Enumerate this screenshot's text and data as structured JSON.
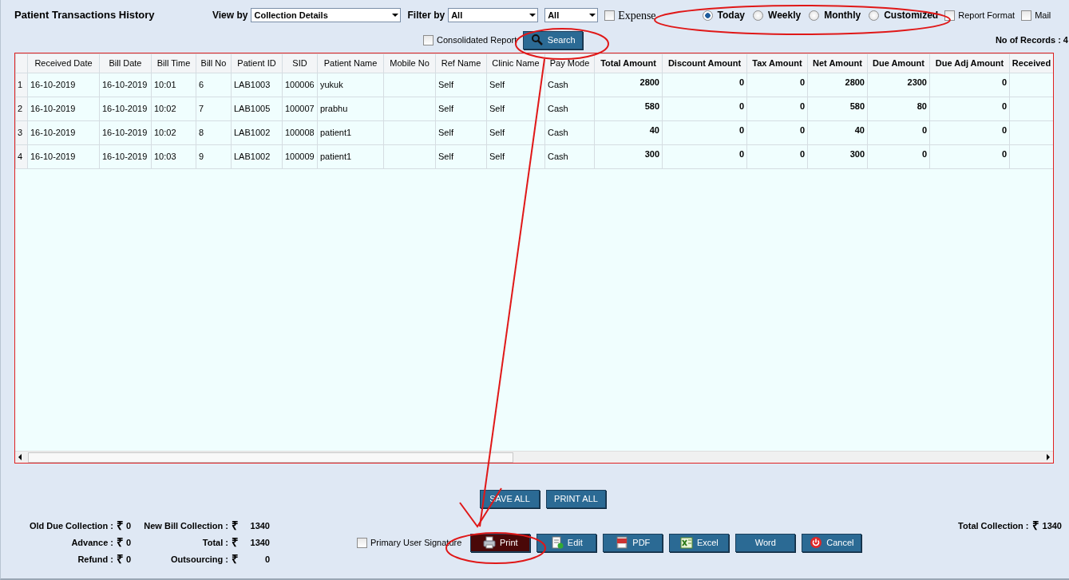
{
  "title": "Patient Transactions History",
  "toolbar": {
    "view_by_label": "View by",
    "view_by_value": "Collection Details",
    "filter_by_label": "Filter by",
    "filter_value": "All",
    "filter2_value": "All",
    "expense": {
      "label": "Expense",
      "checked": false
    },
    "periods": [
      {
        "label": "Today",
        "selected": true
      },
      {
        "label": "Weekly",
        "selected": false
      },
      {
        "label": "Monthly",
        "selected": false
      },
      {
        "label": "Customized",
        "selected": false
      }
    ],
    "report_format": {
      "label": "Report Format",
      "checked": false
    },
    "mail": {
      "label": "Mail",
      "checked": false
    },
    "consolidated": {
      "label": "Consolidated Report",
      "checked": false
    },
    "search_button": "Search",
    "records": "No of Records : 4"
  },
  "table": {
    "columns": [
      {
        "label": "Received Date",
        "kind": "text"
      },
      {
        "label": "Bill Date",
        "kind": "text"
      },
      {
        "label": "Bill Time",
        "kind": "text"
      },
      {
        "label": "Bill No",
        "kind": "text"
      },
      {
        "label": "Patient ID",
        "kind": "text"
      },
      {
        "label": "SID",
        "kind": "text"
      },
      {
        "label": "Patient Name",
        "kind": "text"
      },
      {
        "label": "Mobile No",
        "kind": "text"
      },
      {
        "label": "Ref Name",
        "kind": "text"
      },
      {
        "label": "Clinic Name",
        "kind": "text"
      },
      {
        "label": "Pay Mode",
        "kind": "text"
      },
      {
        "label": "Total Amount",
        "kind": "amount"
      },
      {
        "label": "Discount Amount",
        "kind": "amount"
      },
      {
        "label": "Tax Amount",
        "kind": "amount"
      },
      {
        "label": "Net Amount",
        "kind": "amount"
      },
      {
        "label": "Due Amount",
        "kind": "amount"
      },
      {
        "label": "Due Adj Amount",
        "kind": "amount"
      },
      {
        "label": "Received",
        "kind": "amount"
      }
    ],
    "rows": [
      {
        "index": "1",
        "cells": [
          "16-10-2019",
          "16-10-2019",
          "10:01",
          "6",
          "LAB1003",
          "100006",
          "yukuk",
          null,
          "Self",
          "Self",
          "Cash",
          "2800",
          "0",
          "0",
          "2800",
          "2300",
          "0",
          null
        ]
      },
      {
        "index": "2",
        "cells": [
          "16-10-2019",
          "16-10-2019",
          "10:02",
          "7",
          "LAB1005",
          "100007",
          "prabhu",
          null,
          "Self",
          "Self",
          "Cash",
          "580",
          "0",
          "0",
          "580",
          "80",
          "0",
          null
        ]
      },
      {
        "index": "3",
        "cells": [
          "16-10-2019",
          "16-10-2019",
          "10:02",
          "8",
          "LAB1002",
          "100008",
          "patient1",
          null,
          "Self",
          "Self",
          "Cash",
          "40",
          "0",
          "0",
          "40",
          "0",
          "0",
          null
        ]
      },
      {
        "index": "4",
        "cells": [
          "16-10-2019",
          "16-10-2019",
          "10:03",
          "9",
          "LAB1002",
          "100009",
          "patient1",
          null,
          "Self",
          "Self",
          "Cash",
          "300",
          "0",
          "0",
          "300",
          "0",
          "0",
          null
        ]
      }
    ]
  },
  "bulk_buttons": [
    "SAVE ALL",
    "PRINT ALL"
  ],
  "summary": [
    {
      "label": "Old Due Collection :",
      "currency": "₹",
      "amount": "0"
    },
    {
      "label": "New Bill Collection :",
      "currency": "₹",
      "amount": "1340"
    },
    {
      "label": "Advance :",
      "currency": "₹",
      "amount": "0"
    },
    {
      "label": "Total :",
      "currency": "₹",
      "amount": "1340"
    },
    {
      "label": "Refund :",
      "currency": "₹",
      "amount": "0"
    },
    {
      "label": "Outsourcing :",
      "currency": "₹",
      "amount": "0"
    }
  ],
  "signature": {
    "label": "Primary User Signature",
    "checked": false
  },
  "actions": [
    {
      "label": "Print",
      "kind": "print",
      "selected": true
    },
    {
      "label": "Edit",
      "kind": "edit",
      "selected": false
    },
    {
      "label": "PDF",
      "kind": "pdf",
      "selected": false
    },
    {
      "label": "Excel",
      "kind": "excel",
      "selected": false
    },
    {
      "label": "Word",
      "kind": "word",
      "selected": false
    },
    {
      "label": "Cancel",
      "kind": "cancel",
      "selected": false
    }
  ],
  "total_collection": {
    "label": "Total Collection :",
    "currency": "₹",
    "amount": "1340"
  }
}
